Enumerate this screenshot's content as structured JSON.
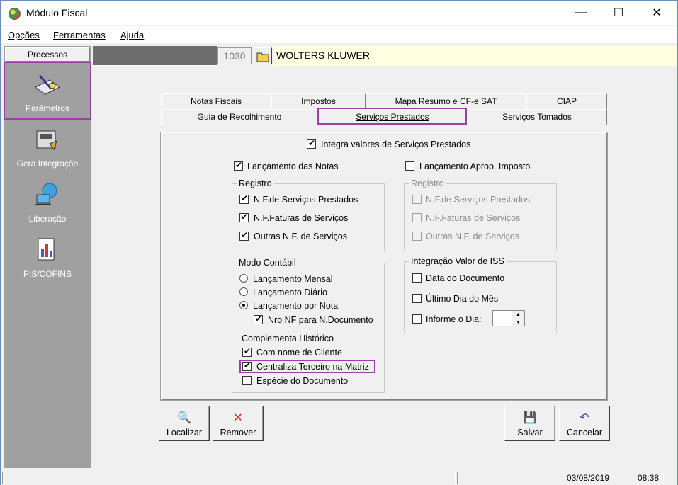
{
  "window": {
    "title": "Módulo Fiscal",
    "minimize": "—",
    "maximize": "☐",
    "close": "✕"
  },
  "menu": [
    "Opções",
    "Ferramentas",
    "Ajuda"
  ],
  "sidebar": {
    "header": "Processos",
    "items": [
      {
        "label": "Parâmetros",
        "icon": "parameters-icon"
      },
      {
        "label": "Gera Integração",
        "icon": "generate-integration-icon"
      },
      {
        "label": "Liberação",
        "icon": "release-icon"
      },
      {
        "label": "PIS/COFINS",
        "icon": "pis-cofins-icon"
      }
    ]
  },
  "company": {
    "code": "1030",
    "name": "WOLTERS KLUWER"
  },
  "tabs_row1": [
    "Notas Fiscais",
    "Impostos",
    "Mapa Resumo e CF-e SAT",
    "CIAP"
  ],
  "tabs_row2": [
    "Guia de Recolhimento",
    "Serviços Prestados",
    "Serviços Tomados"
  ],
  "active_tab": "Serviços Prestados",
  "panel": {
    "integra": {
      "label": "Integra valores de Serviços Prestados",
      "checked": true
    },
    "lanc_notas": {
      "label": "Lançamento das Notas",
      "checked": true
    },
    "lanc_aprop": {
      "label": "Lançamento Aprop. Imposto",
      "checked": false
    },
    "registro_left": {
      "title": "Registro",
      "items": [
        {
          "label": "N.F.de Serviços Prestados",
          "checked": true
        },
        {
          "label": "N.F.Faturas de Serviços",
          "checked": true
        },
        {
          "label": "Outras N.F. de Serviços",
          "checked": true
        }
      ]
    },
    "registro_right": {
      "title": "Registro",
      "items": [
        {
          "label": "N.F.de Serviços Prestados",
          "checked": false
        },
        {
          "label": "N.F.Faturas de Serviços",
          "checked": false
        },
        {
          "label": "Outras N.F. de Serviços",
          "checked": false
        }
      ]
    },
    "modo": {
      "title": "Modo Contábil",
      "options": [
        "Lançamento Mensal",
        "Lançamento Diário",
        "Lançamento por Nota"
      ],
      "selected": "Lançamento por Nota",
      "nro_nf": "Nro NF para N.Documento",
      "hist_title": "Complementa Histórico",
      "hist": [
        {
          "label": "Com nome de Cliente",
          "checked": true
        },
        {
          "label": "Centraliza Terceiro na Matriz",
          "checked": true
        },
        {
          "label": "Espécie do Documento",
          "checked": false
        }
      ]
    },
    "iss": {
      "title": "Integração Valor de ISS",
      "items": [
        "Data do Documento",
        "Último Dia do Mês",
        "Informe o Dia:"
      ],
      "dia_value": ""
    }
  },
  "buttons": {
    "localizar": "Localizar",
    "remover": "Remover",
    "salvar": "Salvar",
    "cancelar": "Cancelar"
  },
  "status": {
    "date": "03/08/2019",
    "time": "08:38"
  }
}
